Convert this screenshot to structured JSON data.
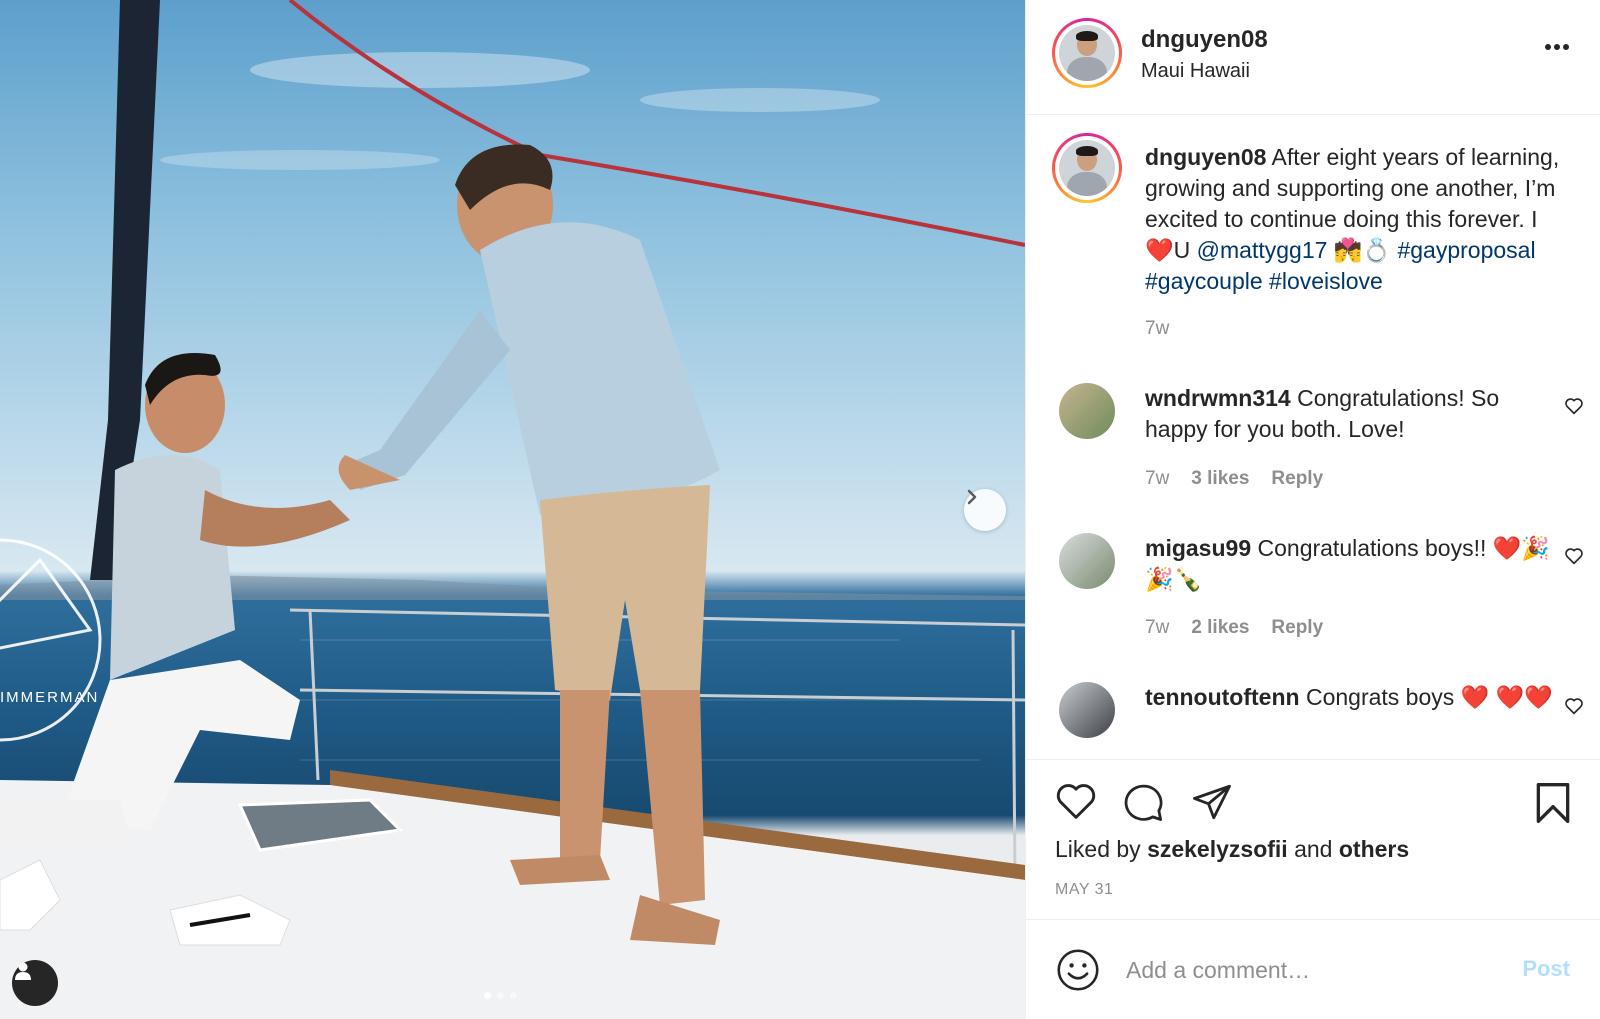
{
  "post": {
    "author": "dnguyen08",
    "location": "Maui Hawaii"
  },
  "caption": {
    "username": "dnguyen08",
    "text_1": "After eight years of learning, growing and supporting one another, I’m excited to continue doing this forever. I",
    "heart_emoji": "❤️",
    "text_2": "U",
    "mention": "@mattygg17",
    "emojis": "💏💍",
    "hashtags": [
      "#gayproposal",
      "#gaycouple",
      "#loveislove"
    ],
    "time": "7w"
  },
  "comments": [
    {
      "username": "wndrwmn314",
      "text": "Congratulations! So happy for you both. Love!",
      "time": "7w",
      "likes": "3 likes",
      "reply": "Reply"
    },
    {
      "username": "migasu99",
      "text": "Congratulations boys!! ❤️🎉🎉🍾",
      "time": "7w",
      "likes": "2 likes",
      "reply": "Reply"
    },
    {
      "username": "tennoutoftenn",
      "text": "Congrats boys ❤️ ❤️❤️"
    }
  ],
  "likes": {
    "prefix": "Liked by",
    "user": "szekelyzsofii",
    "and": "and",
    "others": "others"
  },
  "date": "MAY 31",
  "comment_box": {
    "placeholder": "Add a comment…",
    "post_label": "Post"
  },
  "photo": {
    "watermark": "IMMERMAN",
    "carousel_total": 3,
    "carousel_active": 1
  },
  "colors": {
    "link": "#00376b",
    "muted": "#8e8e8e",
    "post_disabled": "#b2dffc",
    "ring_gradient": [
      "#d6249f",
      "#fd5949",
      "#fdc829"
    ]
  }
}
